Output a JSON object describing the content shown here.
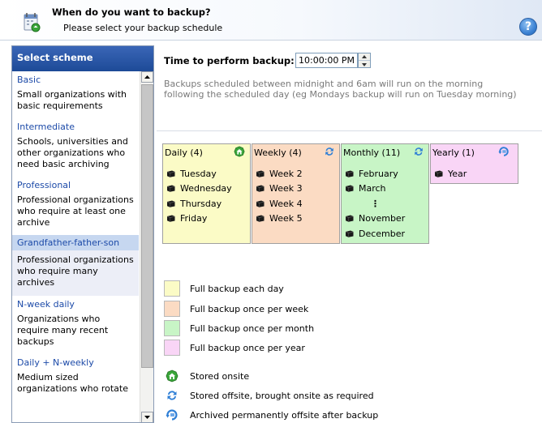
{
  "header": {
    "title": "When do you want to backup?",
    "subtitle": "Please select your backup schedule",
    "help_label": "?"
  },
  "scheme_panel": {
    "title": "Select scheme",
    "schemes": [
      {
        "name": "Basic",
        "description": "Small organizations with basic requirements",
        "selected": false
      },
      {
        "name": "Intermediate",
        "description": "Schools, universities and other organizations who need basic archiving",
        "selected": false
      },
      {
        "name": "Professional",
        "description": "Professional organizations who require at least one archive",
        "selected": false
      },
      {
        "name": "Grandfather-father-son",
        "description": "Professional organizations who require many archives",
        "selected": true
      },
      {
        "name": "N-week daily",
        "description": "Organizations who require many recent backups",
        "selected": false
      },
      {
        "name": "Daily + N-weekly",
        "description": "Medium sized organizations who rotate",
        "selected": false
      }
    ]
  },
  "time": {
    "label": "Time to perform backup:",
    "value": "10:00:00 PM",
    "note": "Backups scheduled between midnight and 6am will run on the morning following the scheduled day (eg Mondays backup will run on Tuesday morning)"
  },
  "periods": {
    "daily": {
      "title": "Daily (4)",
      "icon": "stored-onsite-icon",
      "items": [
        "Tuesday",
        "Wednesday",
        "Thursday",
        "Friday"
      ]
    },
    "weekly": {
      "title": "Weekly (4)",
      "icon": "stored-offsite-icon",
      "items": [
        "Week 2",
        "Week 3",
        "Week 4",
        "Week 5"
      ]
    },
    "monthly": {
      "title": "Monthly (11)",
      "icon": "stored-offsite-icon",
      "items": [
        "February",
        "March",
        "⋮",
        "November",
        "December"
      ]
    },
    "yearly": {
      "title": "Yearly (1)",
      "icon": "archived-offsite-icon",
      "items": [
        "Year"
      ]
    }
  },
  "legend": {
    "colors": [
      {
        "color": "#fbfbc6",
        "label": "Full backup each day"
      },
      {
        "color": "#fbdbc3",
        "label": "Full backup once per week"
      },
      {
        "color": "#c8f5c6",
        "label": "Full backup once per month"
      },
      {
        "color": "#f9d5f6",
        "label": "Full backup once per year"
      }
    ],
    "icons": [
      {
        "icon": "stored-onsite-icon",
        "label": "Stored onsite"
      },
      {
        "icon": "stored-offsite-icon",
        "label": "Stored offsite, brought onsite as required"
      },
      {
        "icon": "archived-offsite-icon",
        "label": "Archived permanently offsite after backup"
      }
    ]
  }
}
